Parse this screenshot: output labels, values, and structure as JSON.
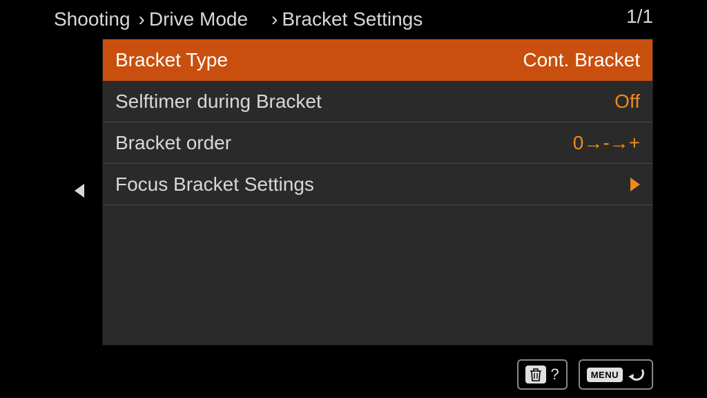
{
  "breadcrumb": {
    "level1": "Shooting",
    "level2": "Drive Mode",
    "level3": "Bracket Settings"
  },
  "page_indicator": "1/1",
  "menu": {
    "items": [
      {
        "label": "Bracket Type",
        "value": "Cont. Bracket",
        "selected": true,
        "submenu": false
      },
      {
        "label": "Selftimer during Bracket",
        "value": "Off",
        "selected": false,
        "submenu": false
      },
      {
        "label": "Bracket order",
        "value": "0→-→+",
        "selected": false,
        "submenu": false
      },
      {
        "label": "Focus Bracket Settings",
        "value": "",
        "selected": false,
        "submenu": true
      }
    ]
  },
  "footer": {
    "help_label": "?",
    "menu_label": "MENU"
  },
  "colors": {
    "accent": "#ed8a1f",
    "selected_bg": "#c94f0e",
    "panel_bg": "#2a2a2a",
    "text": "#d8d8d8"
  }
}
